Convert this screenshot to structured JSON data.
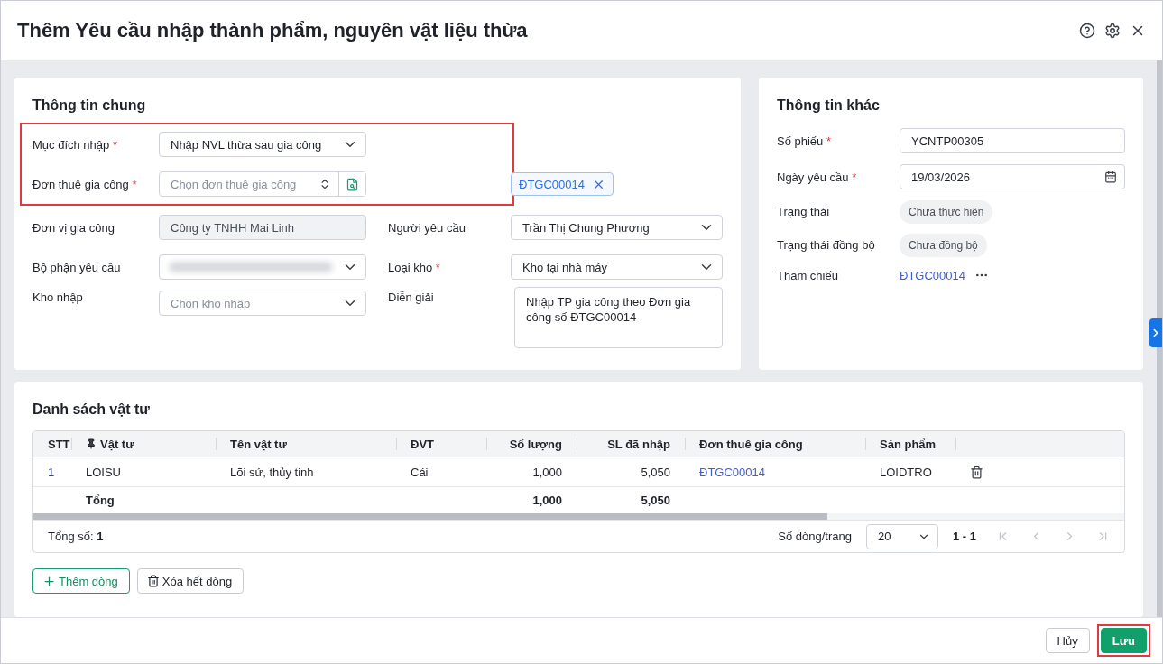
{
  "window": {
    "title": "Thêm Yêu cầu nhập thành phẩm, nguyên vật liệu thừa"
  },
  "header_actions": [
    {
      "kind": "help"
    },
    {
      "kind": "settings"
    },
    {
      "kind": "close"
    }
  ],
  "general": {
    "title": "Thông tin chung",
    "groups": [
      {
        "highlighted": true,
        "rows": [
          {
            "cells": [
              {
                "label": "Mục đích nhập",
                "required_mark": "*",
                "field": {
                  "kind": "select",
                  "value": "Nhập NVL thừa sau gia công"
                }
              }
            ]
          },
          {
            "cells": [
              {
                "label": "Đơn thuê gia công",
                "required_mark": "*",
                "field": {
                  "kind": "lookup",
                  "placeholder": "Chọn đơn thuê gia công"
                }
              },
              {
                "field": {
                  "kind": "tag",
                  "value": "ĐTGC00014"
                }
              }
            ]
          }
        ]
      },
      {
        "highlighted": false,
        "rows": [
          {
            "cells": [
              {
                "label": "Đơn vị gia công",
                "field": {
                  "kind": "input",
                  "value": "Công ty TNHH Mai Linh",
                  "disabled": true
                }
              },
              {
                "label": "Người yêu cầu",
                "field": {
                  "kind": "select",
                  "value": "Trần Thị Chung Phương"
                }
              }
            ]
          },
          {
            "cells": [
              {
                "label": "Bộ phận yêu cầu",
                "field": {
                  "kind": "blurred"
                }
              },
              {
                "label": "Loại kho",
                "required_mark": "*",
                "field": {
                  "kind": "select",
                  "value": "Kho tại nhà máy"
                }
              }
            ]
          },
          {
            "cells": [
              {
                "label": "Kho nhập",
                "field": {
                  "kind": "select",
                  "placeholder": "Chọn kho nhập"
                }
              },
              {
                "label": "Diễn giải",
                "field": {
                  "kind": "textarea",
                  "value": "Nhập TP gia công theo Đơn gia công số ĐTGC00014"
                }
              }
            ]
          }
        ]
      }
    ]
  },
  "other": {
    "title": "Thông tin khác",
    "rows": [
      {
        "label": "Số phiếu",
        "required_mark": "*",
        "field": {
          "kind": "input",
          "value": "YCNTP00305",
          "disabled": false
        }
      },
      {
        "label": "Ngày yêu cầu",
        "required_mark": "*",
        "field": {
          "kind": "date",
          "value": "19/03/2026"
        }
      },
      {
        "label": "Trạng thái",
        "field": {
          "kind": "status",
          "value": "Chưa thực hiện"
        }
      },
      {
        "label": "Trạng thái đồng bộ",
        "field": {
          "kind": "status",
          "value": "Chưa đồng bộ"
        }
      },
      {
        "label": "Tham chiếu",
        "field": {
          "kind": "reference",
          "value": "ĐTGC00014"
        }
      }
    ]
  },
  "materials": {
    "title": "Danh sách vật tư",
    "columns": [
      {
        "label": "STT",
        "pinned": false
      },
      {
        "label": "Vật tư",
        "pinned": true
      },
      {
        "label": "Tên vật tư",
        "pinned": false
      },
      {
        "label": "ĐVT",
        "pinned": false
      },
      {
        "label": "Số lượng",
        "pinned": false
      },
      {
        "label": "SL đã nhập",
        "pinned": false
      },
      {
        "label": "Đơn thuê gia công",
        "pinned": false
      },
      {
        "label": "Sản phẩm",
        "pinned": false
      }
    ],
    "rows": [
      {
        "deletable": true,
        "cells": [
          {
            "kind": "index",
            "text": "1"
          },
          {
            "kind": "text",
            "text": "LOISU"
          },
          {
            "kind": "text",
            "text": "Lõi sứ, thủy tinh"
          },
          {
            "kind": "text",
            "text": "Cái"
          },
          {
            "kind": "number",
            "text": "1,000"
          },
          {
            "kind": "number",
            "text": "5,050"
          },
          {
            "kind": "link",
            "text": "ĐTGC00014"
          },
          {
            "kind": "text",
            "text": "LOIDTRO"
          }
        ]
      }
    ],
    "total": {
      "label": "Tổng",
      "quantity": "1,000",
      "received": "5,050"
    },
    "footer": {
      "total": "Tổng số: **1**",
      "page_size_label": "Số dòng/trang",
      "page_size": "20",
      "range": "1 - 1"
    },
    "pager": [
      {
        "kind": "first",
        "disabled": true
      },
      {
        "kind": "prev",
        "disabled": true
      },
      {
        "kind": "next",
        "disabled": true
      },
      {
        "kind": "last",
        "disabled": true
      }
    ],
    "buttons": [
      {
        "kind": "add",
        "label": "Thêm dòng"
      },
      {
        "kind": "clear",
        "label": "Xóa hết dòng"
      }
    ]
  },
  "footer_buttons": [
    {
      "kind": "secondary",
      "label": "Hủy",
      "highlighted": false
    },
    {
      "kind": "primary",
      "label": "Lưu",
      "highlighted": true
    }
  ]
}
